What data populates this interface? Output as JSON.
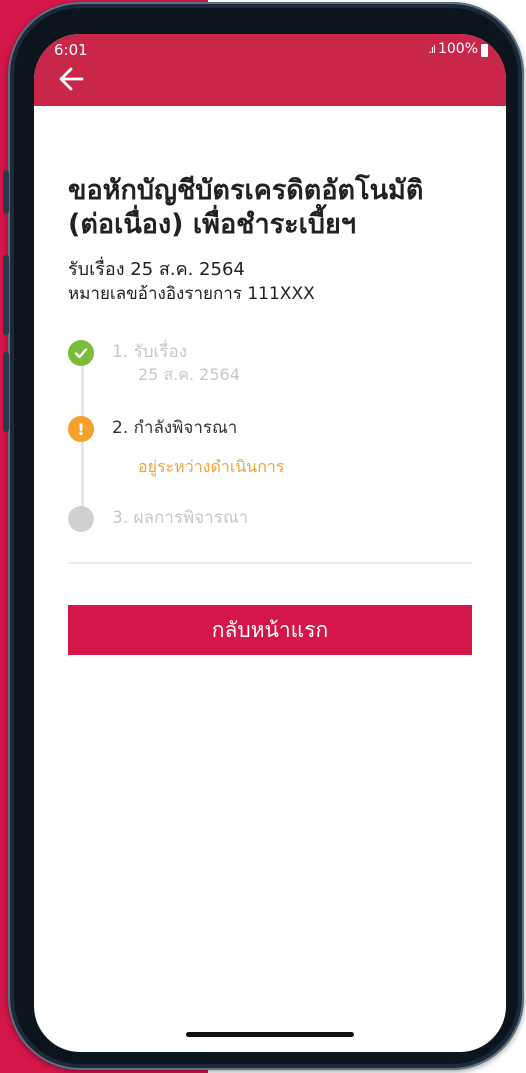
{
  "status_bar": {
    "time": "6:01",
    "signal": ".ıl",
    "battery": "100%"
  },
  "header": {
    "back_icon": "arrow-left-icon"
  },
  "request": {
    "title": "ขอหักบัญชีบัตรเครดิตอัตโนมัติ (ต่อเนื่อง) เพื่อชำระเบี้ยฯ",
    "received_date": "รับเรื่อง 25 ส.ค. 2564",
    "reference": "หมายเลขอ้างอิงรายการ 111XXX"
  },
  "steps": [
    {
      "label": "1. รับเรื่อง",
      "sub": "25 ส.ค. 2564",
      "status": "done",
      "icon": "check-circle-icon"
    },
    {
      "label": "2. กำลังพิจารณา",
      "sub": "อยู่ระหว่างดำเนินการ",
      "status": "active",
      "icon": "exclamation-circle-icon"
    },
    {
      "label": "3. ผลการพิจารณา",
      "sub": "",
      "status": "pending",
      "icon": "pending-circle-icon"
    }
  ],
  "actions": {
    "home_button": "กลับหน้าแรก"
  },
  "colors": {
    "accent": "#d41648",
    "header": "#c8274a",
    "done": "#7cbb3c",
    "active": "#f7a12c",
    "pending": "#d0d0d0"
  }
}
